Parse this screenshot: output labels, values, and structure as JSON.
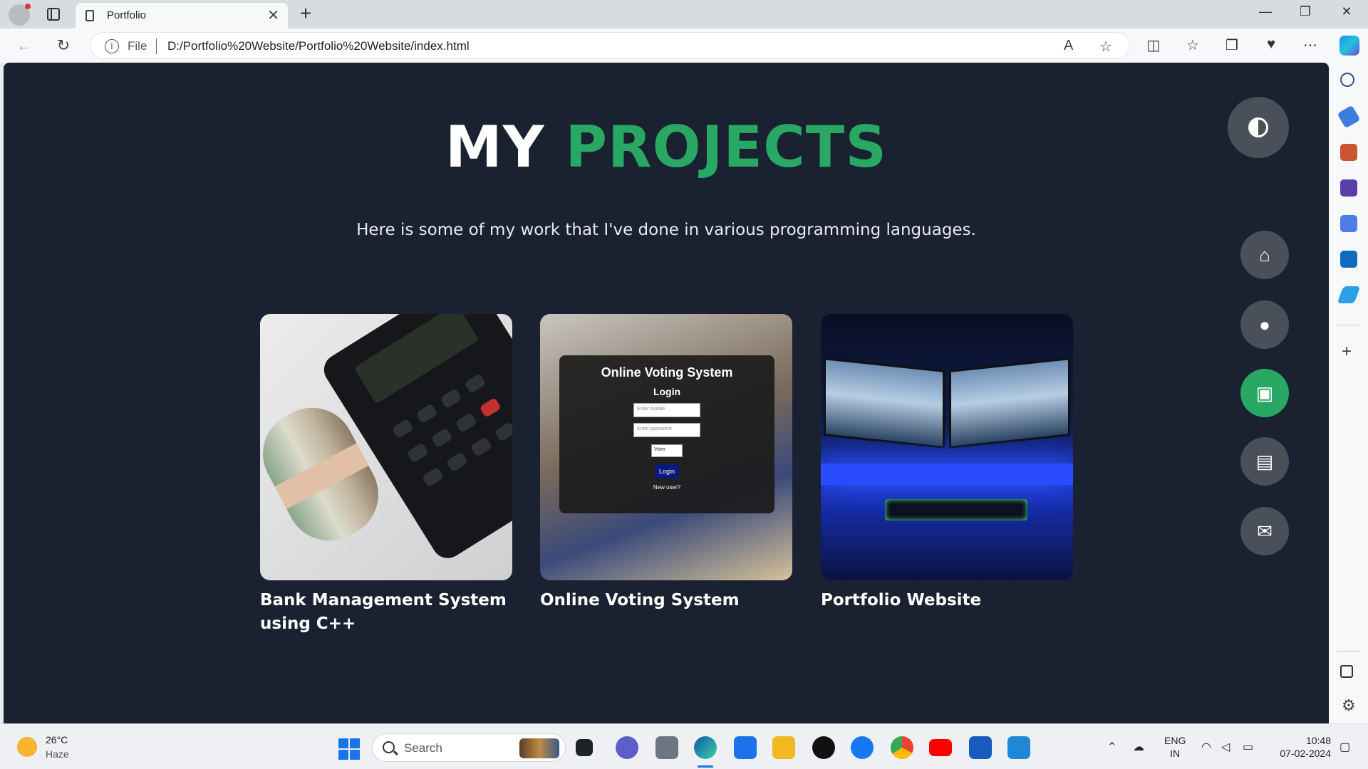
{
  "browser": {
    "tab_title": "Portfolio",
    "tab_close": "✕",
    "new_tab": "+",
    "address_scheme": "File",
    "url": "D:/Portfolio%20Website/Portfolio%20Website/index.html",
    "window_controls": [
      "—",
      "❐",
      "✕"
    ]
  },
  "page": {
    "heading_word1": "MY",
    "heading_word2": "PROJECTS",
    "subtitle": "Here is some of my work that I've done in various programming languages.",
    "accent_color": "#28a862",
    "background_color": "#1a2130",
    "projects": [
      {
        "title": "Bank Management System using C++",
        "image": "calculator-and-cash"
      },
      {
        "title": "Online Voting System",
        "image": "voting-login-screenshot"
      },
      {
        "title": "Portfolio Website",
        "image": "dual-monitor-setup"
      }
    ],
    "voting_preview": {
      "title": "Online Voting System",
      "login_heading": "Login",
      "mobile_placeholder": "Enter mobile",
      "password_placeholder": "Enter password",
      "role_option": "Voter",
      "login_button": "Login",
      "new_user": "New user?"
    },
    "controls": [
      "home-icon",
      "user-icon",
      "briefcase-icon",
      "newspaper-icon",
      "envelope-icon"
    ],
    "active_control": "briefcase-icon"
  },
  "taskbar": {
    "temperature": "26°C",
    "condition": "Haze",
    "search_placeholder": "Search",
    "language_line1": "ENG",
    "language_line2": "IN",
    "time": "10:48",
    "date": "07-02-2024"
  }
}
